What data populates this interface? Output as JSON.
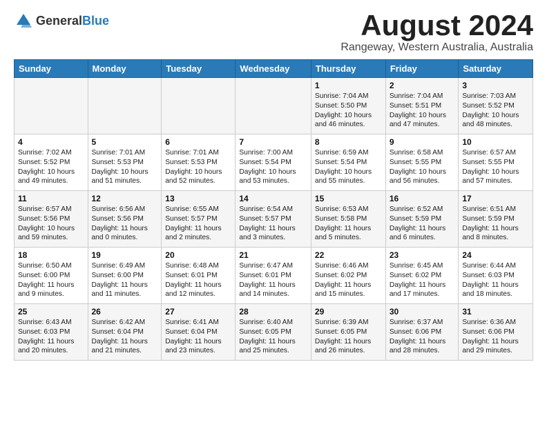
{
  "header": {
    "logo_general": "General",
    "logo_blue": "Blue",
    "month": "August 2024",
    "location": "Rangeway, Western Australia, Australia"
  },
  "columns": [
    "Sunday",
    "Monday",
    "Tuesday",
    "Wednesday",
    "Thursday",
    "Friday",
    "Saturday"
  ],
  "weeks": [
    [
      {
        "day": "",
        "info": ""
      },
      {
        "day": "",
        "info": ""
      },
      {
        "day": "",
        "info": ""
      },
      {
        "day": "",
        "info": ""
      },
      {
        "day": "1",
        "info": "Sunrise: 7:04 AM\nSunset: 5:50 PM\nDaylight: 10 hours\nand 46 minutes."
      },
      {
        "day": "2",
        "info": "Sunrise: 7:04 AM\nSunset: 5:51 PM\nDaylight: 10 hours\nand 47 minutes."
      },
      {
        "day": "3",
        "info": "Sunrise: 7:03 AM\nSunset: 5:52 PM\nDaylight: 10 hours\nand 48 minutes."
      }
    ],
    [
      {
        "day": "4",
        "info": "Sunrise: 7:02 AM\nSunset: 5:52 PM\nDaylight: 10 hours\nand 49 minutes."
      },
      {
        "day": "5",
        "info": "Sunrise: 7:01 AM\nSunset: 5:53 PM\nDaylight: 10 hours\nand 51 minutes."
      },
      {
        "day": "6",
        "info": "Sunrise: 7:01 AM\nSunset: 5:53 PM\nDaylight: 10 hours\nand 52 minutes."
      },
      {
        "day": "7",
        "info": "Sunrise: 7:00 AM\nSunset: 5:54 PM\nDaylight: 10 hours\nand 53 minutes."
      },
      {
        "day": "8",
        "info": "Sunrise: 6:59 AM\nSunset: 5:54 PM\nDaylight: 10 hours\nand 55 minutes."
      },
      {
        "day": "9",
        "info": "Sunrise: 6:58 AM\nSunset: 5:55 PM\nDaylight: 10 hours\nand 56 minutes."
      },
      {
        "day": "10",
        "info": "Sunrise: 6:57 AM\nSunset: 5:55 PM\nDaylight: 10 hours\nand 57 minutes."
      }
    ],
    [
      {
        "day": "11",
        "info": "Sunrise: 6:57 AM\nSunset: 5:56 PM\nDaylight: 10 hours\nand 59 minutes."
      },
      {
        "day": "12",
        "info": "Sunrise: 6:56 AM\nSunset: 5:56 PM\nDaylight: 11 hours\nand 0 minutes."
      },
      {
        "day": "13",
        "info": "Sunrise: 6:55 AM\nSunset: 5:57 PM\nDaylight: 11 hours\nand 2 minutes."
      },
      {
        "day": "14",
        "info": "Sunrise: 6:54 AM\nSunset: 5:57 PM\nDaylight: 11 hours\nand 3 minutes."
      },
      {
        "day": "15",
        "info": "Sunrise: 6:53 AM\nSunset: 5:58 PM\nDaylight: 11 hours\nand 5 minutes."
      },
      {
        "day": "16",
        "info": "Sunrise: 6:52 AM\nSunset: 5:59 PM\nDaylight: 11 hours\nand 6 minutes."
      },
      {
        "day": "17",
        "info": "Sunrise: 6:51 AM\nSunset: 5:59 PM\nDaylight: 11 hours\nand 8 minutes."
      }
    ],
    [
      {
        "day": "18",
        "info": "Sunrise: 6:50 AM\nSunset: 6:00 PM\nDaylight: 11 hours\nand 9 minutes."
      },
      {
        "day": "19",
        "info": "Sunrise: 6:49 AM\nSunset: 6:00 PM\nDaylight: 11 hours\nand 11 minutes."
      },
      {
        "day": "20",
        "info": "Sunrise: 6:48 AM\nSunset: 6:01 PM\nDaylight: 11 hours\nand 12 minutes."
      },
      {
        "day": "21",
        "info": "Sunrise: 6:47 AM\nSunset: 6:01 PM\nDaylight: 11 hours\nand 14 minutes."
      },
      {
        "day": "22",
        "info": "Sunrise: 6:46 AM\nSunset: 6:02 PM\nDaylight: 11 hours\nand 15 minutes."
      },
      {
        "day": "23",
        "info": "Sunrise: 6:45 AM\nSunset: 6:02 PM\nDaylight: 11 hours\nand 17 minutes."
      },
      {
        "day": "24",
        "info": "Sunrise: 6:44 AM\nSunset: 6:03 PM\nDaylight: 11 hours\nand 18 minutes."
      }
    ],
    [
      {
        "day": "25",
        "info": "Sunrise: 6:43 AM\nSunset: 6:03 PM\nDaylight: 11 hours\nand 20 minutes."
      },
      {
        "day": "26",
        "info": "Sunrise: 6:42 AM\nSunset: 6:04 PM\nDaylight: 11 hours\nand 21 minutes."
      },
      {
        "day": "27",
        "info": "Sunrise: 6:41 AM\nSunset: 6:04 PM\nDaylight: 11 hours\nand 23 minutes."
      },
      {
        "day": "28",
        "info": "Sunrise: 6:40 AM\nSunset: 6:05 PM\nDaylight: 11 hours\nand 25 minutes."
      },
      {
        "day": "29",
        "info": "Sunrise: 6:39 AM\nSunset: 6:05 PM\nDaylight: 11 hours\nand 26 minutes."
      },
      {
        "day": "30",
        "info": "Sunrise: 6:37 AM\nSunset: 6:06 PM\nDaylight: 11 hours\nand 28 minutes."
      },
      {
        "day": "31",
        "info": "Sunrise: 6:36 AM\nSunset: 6:06 PM\nDaylight: 11 hours\nand 29 minutes."
      }
    ]
  ]
}
